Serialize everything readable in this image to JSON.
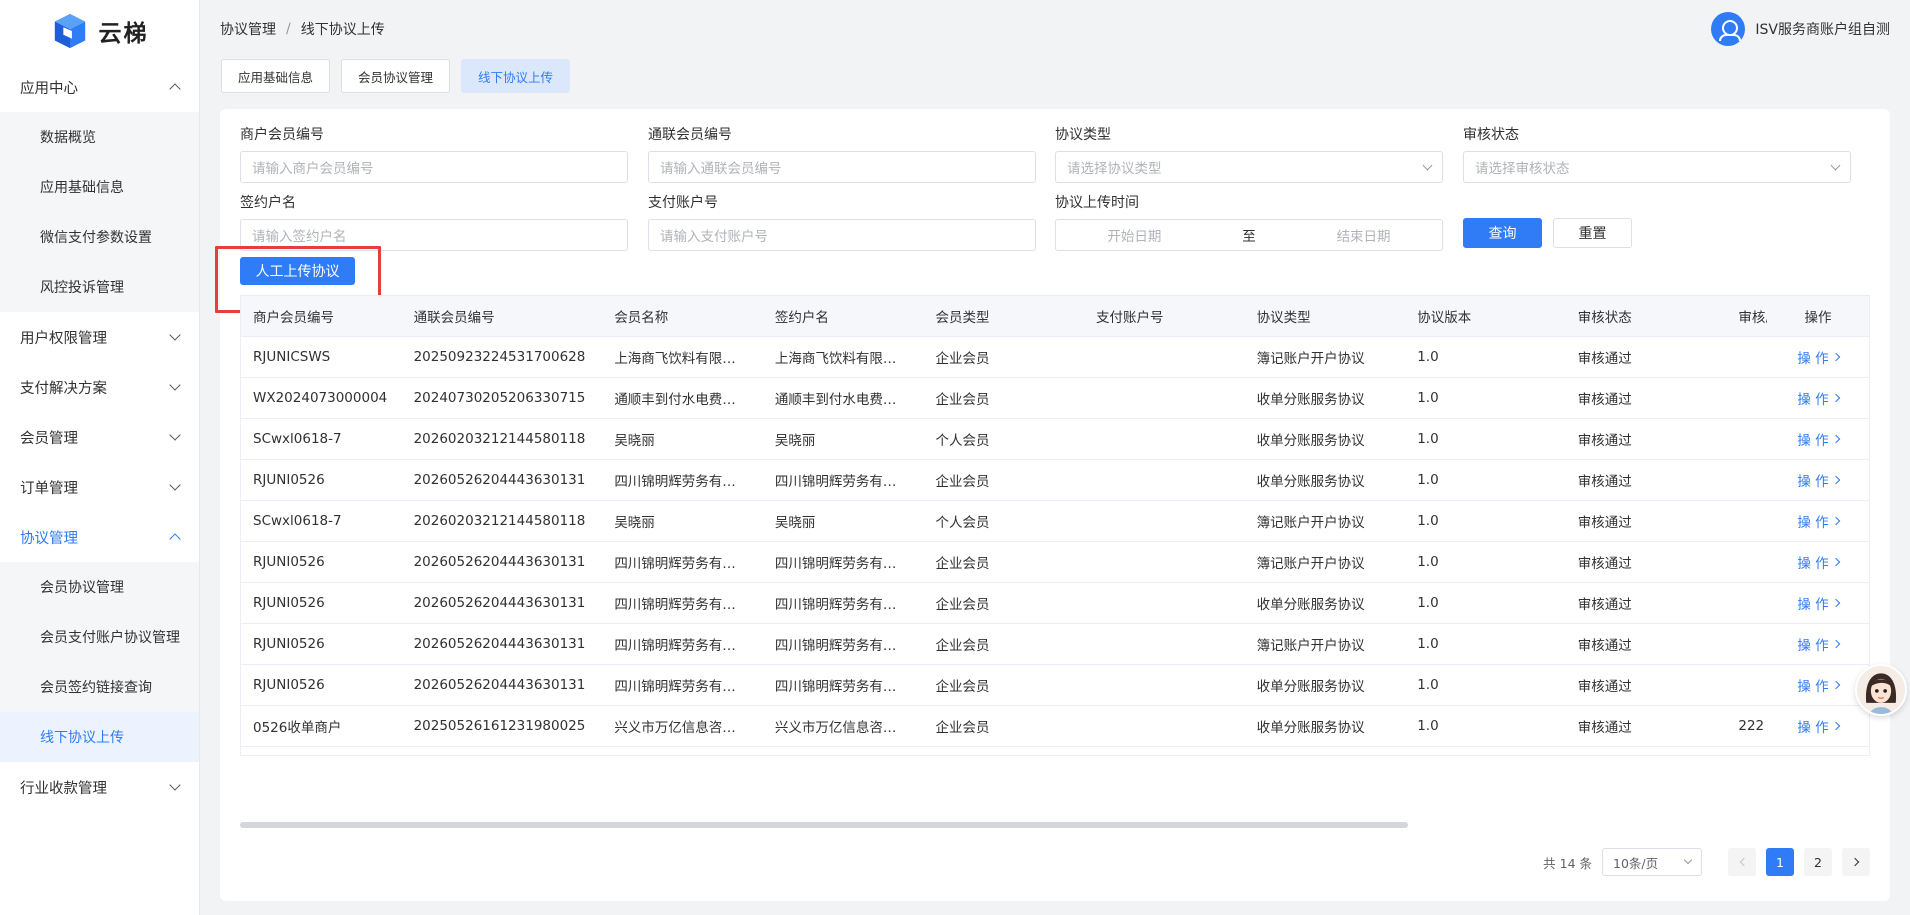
{
  "brand": {
    "name": "云梯"
  },
  "sidebar": {
    "groups": [
      {
        "label": "应用中心",
        "expanded": true,
        "items": [
          "数据概览",
          "应用基础信息",
          "微信支付参数设置",
          "风控投诉管理"
        ]
      },
      {
        "label": "用户权限管理",
        "expanded": false
      },
      {
        "label": "支付解决方案",
        "expanded": false
      },
      {
        "label": "会员管理",
        "expanded": false
      },
      {
        "label": "订单管理",
        "expanded": false
      },
      {
        "label": "协议管理",
        "expanded": true,
        "active": true,
        "items": [
          "会员协议管理",
          "会员支付账户协议管理",
          "会员签约链接查询",
          "线下协议上传"
        ],
        "selected": "线下协议上传"
      },
      {
        "label": "行业收款管理",
        "expanded": false
      }
    ]
  },
  "header": {
    "breadcrumb": [
      "协议管理",
      "线下协议上传"
    ],
    "separator": "/",
    "user": "ISV服务商账户组自测"
  },
  "tabs": [
    {
      "label": "应用基础信息",
      "active": false
    },
    {
      "label": "会员协议管理",
      "active": false
    },
    {
      "label": "线下协议上传",
      "active": true
    }
  ],
  "filters": {
    "merchant_member_no": {
      "label": "商户会员编号",
      "placeholder": "请输入商户会员编号"
    },
    "union_member_no": {
      "label": "通联会员编号",
      "placeholder": "请输入通联会员编号"
    },
    "agreement_type": {
      "label": "协议类型",
      "placeholder": "请选择协议类型"
    },
    "audit_status": {
      "label": "审核状态",
      "placeholder": "请选择审核状态"
    },
    "signer_name": {
      "label": "签约户名",
      "placeholder": "请输入签约户名"
    },
    "pay_account_no": {
      "label": "支付账户号",
      "placeholder": "请输入支付账户号"
    },
    "upload_time": {
      "label": "协议上传时间",
      "start": "开始日期",
      "to": "至",
      "end": "结束日期"
    },
    "query_label": "查询",
    "reset_label": "重置"
  },
  "upload_button": "人工上传协议",
  "table": {
    "columns": [
      "商户会员编号",
      "通联会员编号",
      "会员名称",
      "签约户名",
      "会员类型",
      "支付账户号",
      "协议类型",
      "协议版本",
      "审核状态",
      "审核原",
      "操作"
    ],
    "op_label": "操 作",
    "rows": [
      [
        "RJUNICSWS",
        "20250923224531700628",
        "上海商飞饮料有限…",
        "上海商飞饮料有限…",
        "企业会员",
        "",
        "簿记账户开户协议",
        "1.0",
        "审核通过",
        ""
      ],
      [
        "WX2024073000004",
        "20240730205206330715",
        "通顺丰到付水电费…",
        "通顺丰到付水电费…",
        "企业会员",
        "",
        "收单分账服务协议",
        "1.0",
        "审核通过",
        ""
      ],
      [
        "SCwxl0618-7",
        "20260203212144580118",
        "吴晓丽",
        "吴晓丽",
        "个人会员",
        "",
        "收单分账服务协议",
        "1.0",
        "审核通过",
        ""
      ],
      [
        "RJUNI0526",
        "20260526204443630131",
        "四川锦明辉劳务有…",
        "四川锦明辉劳务有…",
        "企业会员",
        "",
        "收单分账服务协议",
        "1.0",
        "审核通过",
        ""
      ],
      [
        "SCwxl0618-7",
        "20260203212144580118",
        "吴晓丽",
        "吴晓丽",
        "个人会员",
        "",
        "簿记账户开户协议",
        "1.0",
        "审核通过",
        ""
      ],
      [
        "RJUNI0526",
        "20260526204443630131",
        "四川锦明辉劳务有…",
        "四川锦明辉劳务有…",
        "企业会员",
        "",
        "簿记账户开户协议",
        "1.0",
        "审核通过",
        ""
      ],
      [
        "RJUNI0526",
        "20260526204443630131",
        "四川锦明辉劳务有…",
        "四川锦明辉劳务有…",
        "企业会员",
        "",
        "收单分账服务协议",
        "1.0",
        "审核通过",
        ""
      ],
      [
        "RJUNI0526",
        "20260526204443630131",
        "四川锦明辉劳务有…",
        "四川锦明辉劳务有…",
        "企业会员",
        "",
        "簿记账户开户协议",
        "1.0",
        "审核通过",
        ""
      ],
      [
        "RJUNI0526",
        "20260526204443630131",
        "四川锦明辉劳务有…",
        "四川锦明辉劳务有…",
        "企业会员",
        "",
        "收单分账服务协议",
        "1.0",
        "审核通过",
        ""
      ],
      [
        "0526收单商户",
        "20250526161231980025",
        "兴义市万亿信息咨…",
        "兴义市万亿信息咨…",
        "企业会员",
        "",
        "收单分账服务协议",
        "1.0",
        "审核通过",
        "222"
      ]
    ]
  },
  "pagination": {
    "total_text": "共 14 条",
    "page_size": "10条/页",
    "pages": [
      "1",
      "2"
    ],
    "current": "1"
  },
  "colors": {
    "primary": "#2f7cf6",
    "highlight": "#e53e3e"
  }
}
